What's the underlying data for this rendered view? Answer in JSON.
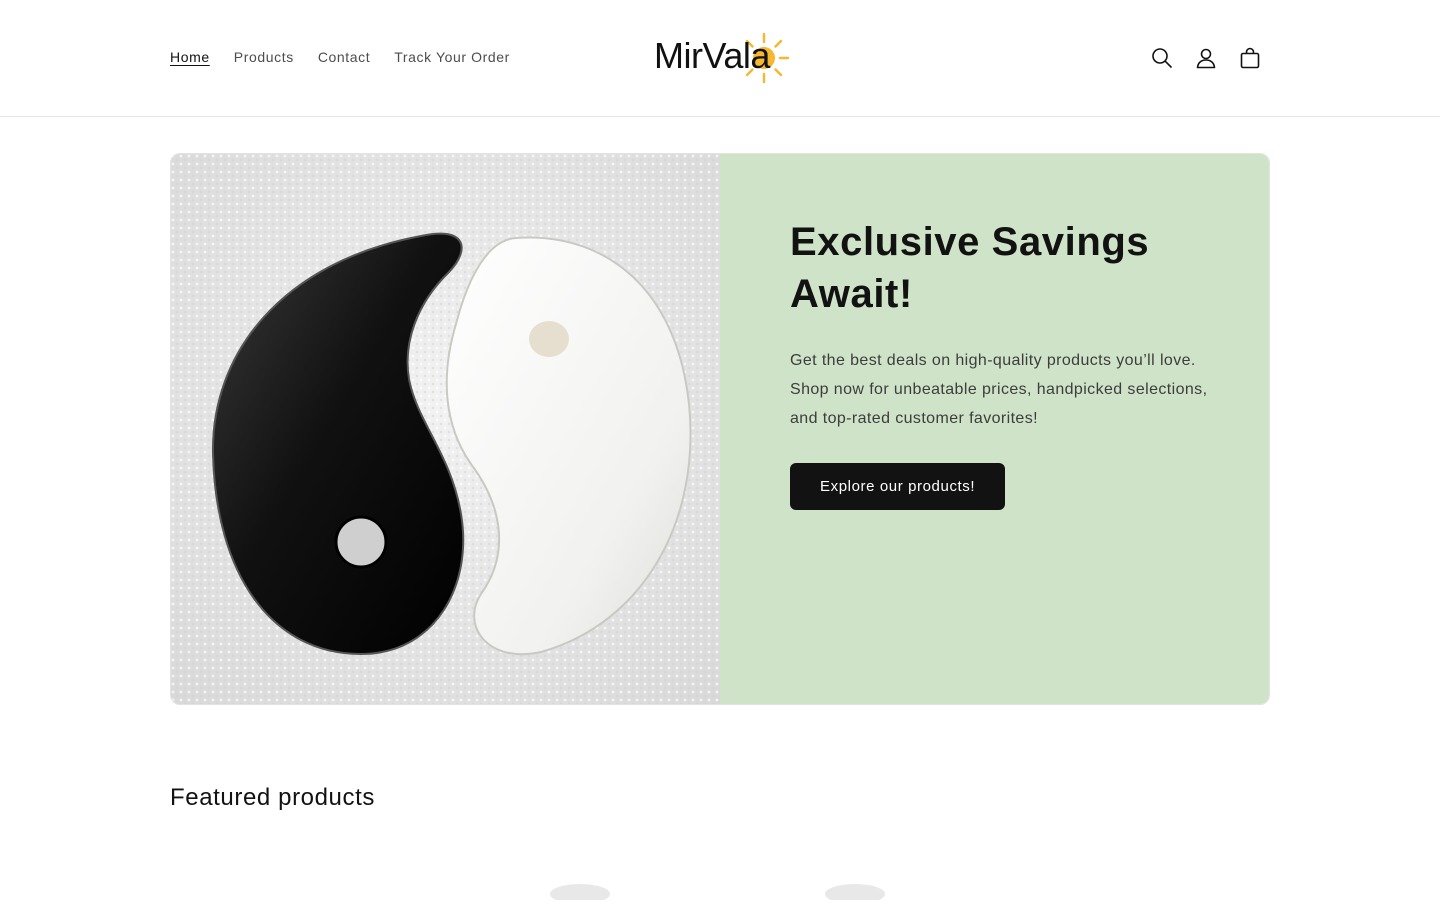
{
  "header": {
    "nav": [
      {
        "label": "Home",
        "active": true
      },
      {
        "label": "Products",
        "active": false
      },
      {
        "label": "Contact",
        "active": false
      },
      {
        "label": "Track Your Order",
        "active": false
      }
    ],
    "logo_text": "MirVala",
    "icons": [
      "search-icon",
      "account-icon",
      "cart-icon"
    ]
  },
  "banner": {
    "title": "Exclusive Savings Await!",
    "description": "Get the best deals on high-quality products you’ll love. Shop now for unbeatable prices, handpicked selections, and top-rated customer favorites!",
    "button_label": "Explore our products!",
    "background_color": "#cfe3c8",
    "image_subject": "black and white yin-yang gua sha stones on white towel"
  },
  "featured": {
    "title": "Featured products"
  },
  "colors": {
    "accent_dark": "#121212",
    "sun_yellow": "#f5b82e"
  }
}
